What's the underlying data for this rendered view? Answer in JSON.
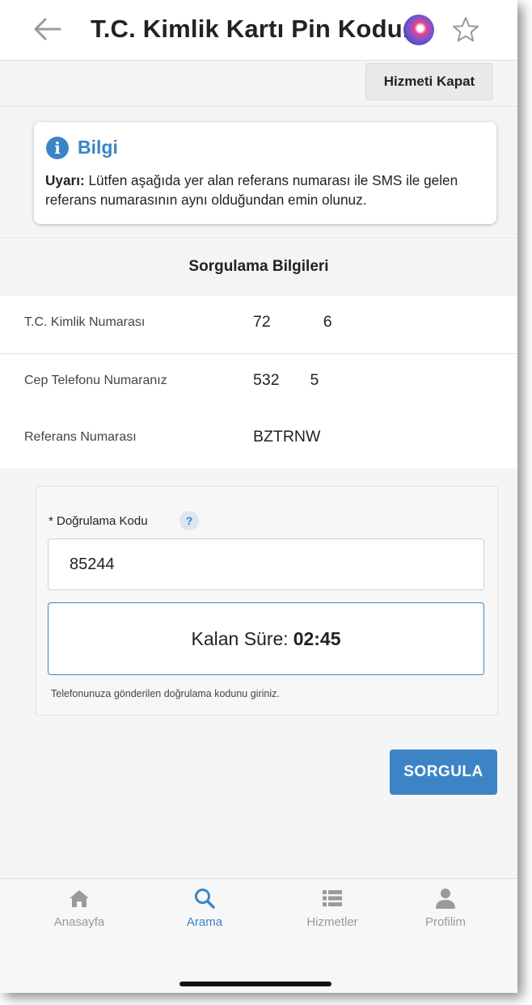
{
  "header": {
    "title": "T.C. Kimlik Kartı Pin Kodu...",
    "back_icon": "arrow-left-icon",
    "assistant_icon": "siri-icon",
    "favorite_icon": "star-outline-icon"
  },
  "toolbar": {
    "close_label": "Hizmeti Kapat"
  },
  "info": {
    "icon": "info-icon",
    "title": "Bilgi",
    "warning_prefix": "Uyarı:",
    "warning_text": " Lütfen aşağıda yer alan referans numarası ile SMS ile gelen referans numarasının aynı olduğundan emin olunuz."
  },
  "query": {
    "title": "Sorgulama Bilgileri",
    "rows": [
      {
        "label": "T.C. Kimlik Numarası",
        "value": "72            6"
      },
      {
        "label": "Cep Telefonu Numaranız",
        "value": "532       5"
      },
      {
        "label": "Referans Numarası",
        "value": "BZTRNW"
      }
    ]
  },
  "form": {
    "code_label": "* Doğrulama Kodu",
    "help_glyph": "?",
    "code_value": "85244",
    "timer_label": "Kalan Süre:",
    "timer_value": "02:45",
    "hint": "Telefonunuza gönderilen doğrulama kodunu giriniz."
  },
  "actions": {
    "submit_label": "SORGULA"
  },
  "tabs": [
    {
      "label": "Anasayfa",
      "icon": "home-icon",
      "active": false
    },
    {
      "label": "Arama",
      "icon": "search-icon",
      "active": true
    },
    {
      "label": "Hizmetler",
      "icon": "list-icon",
      "active": false
    },
    {
      "label": "Profilim",
      "icon": "person-icon",
      "active": false
    }
  ],
  "colors": {
    "accent": "#3c84c6",
    "inactive_tab": "#9a9a9a",
    "background": "#f5f5f5"
  }
}
